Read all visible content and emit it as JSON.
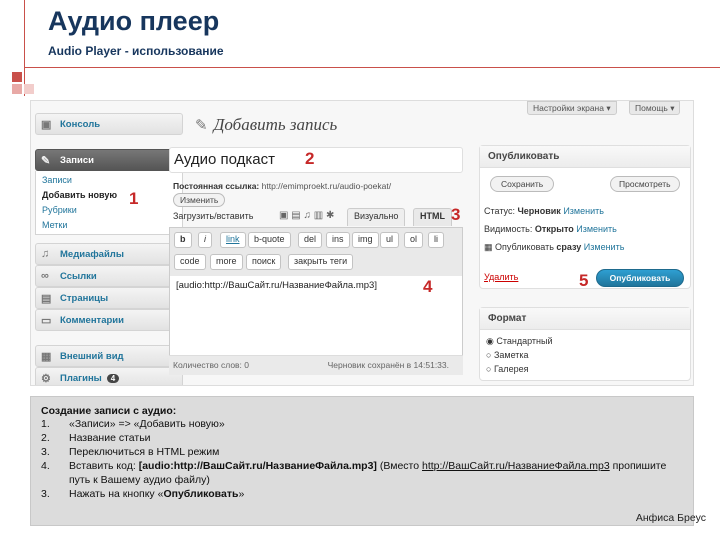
{
  "slide": {
    "title": "Аудио плеер",
    "subtitle": "Audio Player - использование",
    "author": "Анфиса Бреус",
    "accent_color": "#c9504a",
    "title_color": "#17365d"
  },
  "wp": {
    "top_buttons": [
      "Настройки экрана ▾",
      "Помощь ▾"
    ],
    "sidebar": {
      "items": [
        {
          "label": "Консоль",
          "icon": "dashboard-icon"
        },
        {
          "label": "Записи",
          "icon": "pin-icon"
        },
        {
          "label": "Медиафайлы",
          "icon": "media-icon"
        },
        {
          "label": "Ссылки",
          "icon": "link-icon"
        },
        {
          "label": "Страницы",
          "icon": "page-icon"
        },
        {
          "label": "Комментарии",
          "icon": "comment-icon"
        },
        {
          "label": "Внешний вид",
          "icon": "appearance-icon"
        },
        {
          "label": "Плагины",
          "icon": "plugin-icon"
        }
      ],
      "posts_sub": [
        "Записи",
        "Добавить новую",
        "Рубрики",
        "Метки"
      ],
      "plugins_badge": "4"
    },
    "page_title": "Добавить запись",
    "post_title": "Аудио подкаст",
    "permalink_label": "Постоянная ссылка:",
    "permalink_url": "http://emimproekt.ru/audio-poekat/",
    "edit_button": "Изменить",
    "upload_label": "Загрузить/вставить",
    "tab_visual": "Визуально",
    "tab_html": "HTML",
    "quicktags_row1": [
      "b",
      "i",
      "link",
      "b-quote",
      "del",
      "ins",
      "img",
      "ul",
      "ol",
      "li"
    ],
    "quicktags_row2": [
      "code",
      "more",
      "поиск",
      "закрыть теги"
    ],
    "editor_content": "[audio:http://ВашСайт.ru/НазваниеФайла.mp3]",
    "word_count": "Количество слов: 0",
    "draft_saved": "Черновик сохранён в 14:51:33.",
    "publish_box": {
      "heading": "Опубликовать",
      "save_button": "Сохранить",
      "preview_button": "Просмотреть",
      "status_label": "Статус:",
      "status_value": "Черновик",
      "visibility_label": "Видимость:",
      "visibility_value": "Открыто",
      "publish_label": "Опубликовать",
      "publish_value": "сразу",
      "edit_link": "Изменить",
      "delete_link": "Удалить",
      "publish_button": "Опубликовать"
    },
    "format_box": {
      "heading": "Формат",
      "options": [
        "Стандартный",
        "Заметка",
        "Галерея"
      ],
      "selected": "Стандартный"
    }
  },
  "callouts": [
    "1",
    "2",
    "3",
    "4",
    "5"
  ],
  "notes": {
    "heading": "Создание записи с аудио:",
    "steps": [
      {
        "n": "1.",
        "text": "«Записи» => «Добавить новую»"
      },
      {
        "n": "2.",
        "text": "Название статьи"
      },
      {
        "n": "3.",
        "text": "Переключиться в HTML режим"
      },
      {
        "n": "4.",
        "text_pre": "Вставить код: ",
        "code": "[audio:http://ВашСайт.ru/НазваниеФайла.mp3]",
        "text_mid": " (Вместо ",
        "link": "http://ВашСайт.ru/НазваниеФайла.mp3",
        "text_post": " пропишите путь к Вашему аудио файлу)"
      },
      {
        "n": "3.",
        "text_pre": "Нажать на кнопку «",
        "bold": "Опубликовать",
        "text_post": "»"
      }
    ]
  }
}
